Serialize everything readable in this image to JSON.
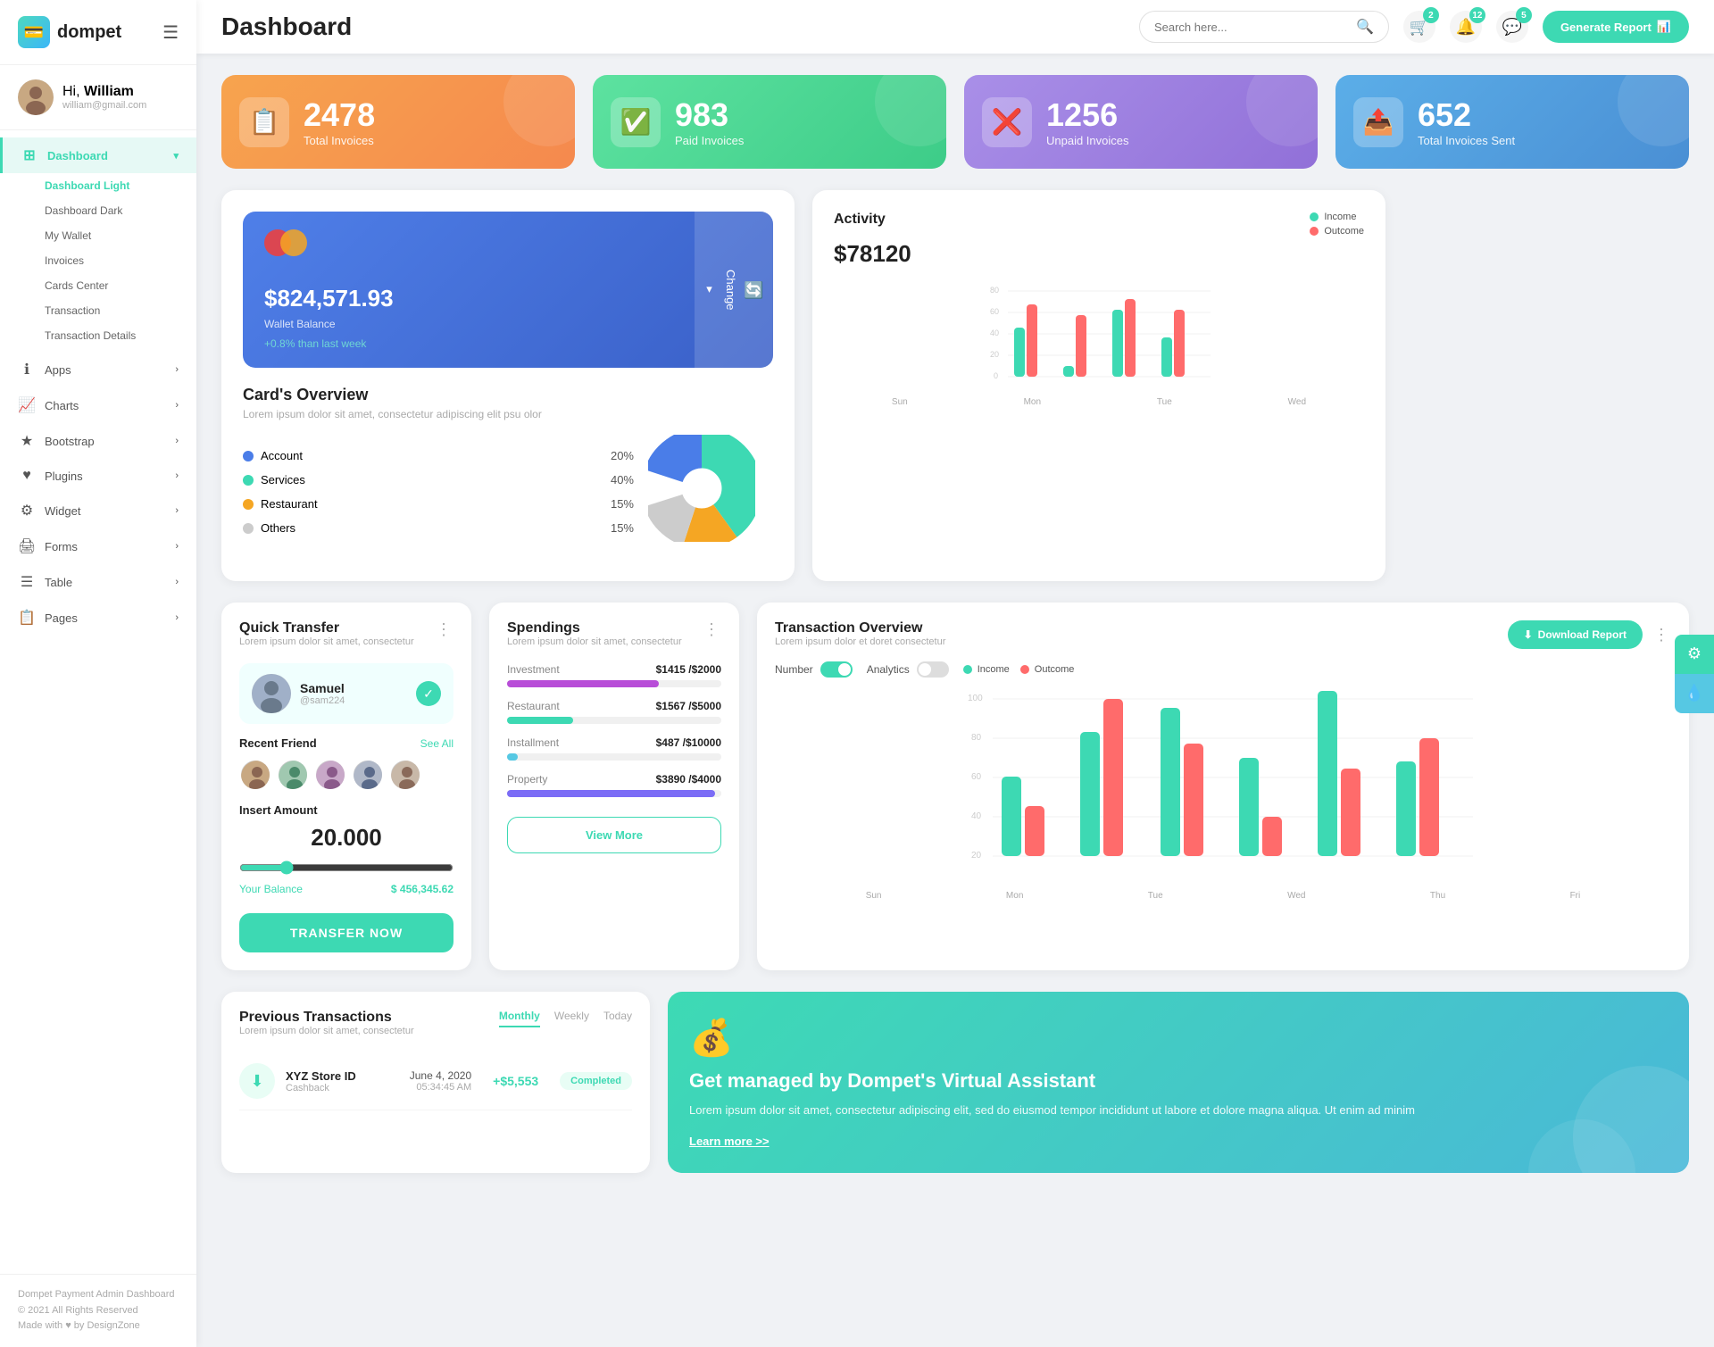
{
  "sidebar": {
    "logo_text": "dompet",
    "user": {
      "greeting": "Hi,",
      "name": "William",
      "email": "william@gmail.com"
    },
    "nav": [
      {
        "id": "dashboard",
        "label": "Dashboard",
        "icon": "⊞",
        "active": true,
        "badge": null,
        "arrow": "▾",
        "sub_items": [
          {
            "label": "Dashboard Light",
            "active": true
          },
          {
            "label": "Dashboard Dark",
            "active": false
          },
          {
            "label": "My Wallet",
            "active": false
          },
          {
            "label": "Invoices",
            "active": false
          },
          {
            "label": "Cards Center",
            "active": false
          },
          {
            "label": "Transaction",
            "active": false
          },
          {
            "label": "Transaction Details",
            "active": false
          }
        ]
      },
      {
        "id": "apps",
        "label": "Apps",
        "icon": "ℹ",
        "arrow": "›"
      },
      {
        "id": "charts",
        "label": "Charts",
        "icon": "📈",
        "arrow": "›"
      },
      {
        "id": "bootstrap",
        "label": "Bootstrap",
        "icon": "★",
        "arrow": "›"
      },
      {
        "id": "plugins",
        "label": "Plugins",
        "icon": "♥",
        "arrow": "›"
      },
      {
        "id": "widget",
        "label": "Widget",
        "icon": "⚙",
        "arrow": "›"
      },
      {
        "id": "forms",
        "label": "Forms",
        "icon": "🖨",
        "arrow": "›"
      },
      {
        "id": "table",
        "label": "Table",
        "icon": "☰",
        "arrow": "›"
      },
      {
        "id": "pages",
        "label": "Pages",
        "icon": "📋",
        "arrow": "›"
      }
    ],
    "footer": {
      "brand": "Dompet Payment Admin Dashboard",
      "copyright": "© 2021 All Rights Reserved",
      "made_with": "Made with ♥ by DesignZone"
    }
  },
  "header": {
    "title": "Dashboard",
    "search_placeholder": "Search here...",
    "icons": {
      "cart_badge": "2",
      "bell_badge": "12",
      "chat_badge": "5"
    },
    "generate_btn": "Generate Report"
  },
  "stat_cards": [
    {
      "number": "2478",
      "label": "Total Invoices",
      "color": "orange",
      "icon": "📋"
    },
    {
      "number": "983",
      "label": "Paid Invoices",
      "color": "green",
      "icon": "✓"
    },
    {
      "number": "1256",
      "label": "Unpaid Invoices",
      "color": "purple",
      "icon": "✗"
    },
    {
      "number": "652",
      "label": "Total Invoices Sent",
      "color": "teal",
      "icon": "📋"
    }
  ],
  "wallet_card": {
    "balance": "$824,571.93",
    "label": "Wallet Balance",
    "growth": "+0.8% than last week",
    "change_btn": "Change"
  },
  "cards_overview": {
    "title": "Card's Overview",
    "sub": "Lorem ipsum dolor sit amet, consectetur adipiscing elit psu olor",
    "items": [
      {
        "label": "Account",
        "pct": "20%",
        "color": "#4a7de8"
      },
      {
        "label": "Services",
        "pct": "40%",
        "color": "#3dd9b3"
      },
      {
        "label": "Restaurant",
        "pct": "15%",
        "color": "#f5a623"
      },
      {
        "label": "Others",
        "pct": "15%",
        "color": "#ccc"
      }
    ]
  },
  "activity": {
    "title": "Activity",
    "amount": "$78120",
    "income_label": "Income",
    "outcome_label": "Outcome",
    "income_color": "#3dd9b3",
    "outcome_color": "#ff6b6b",
    "bars": {
      "labels": [
        "Sun",
        "Mon",
        "Tue",
        "Wed"
      ],
      "income": [
        45,
        10,
        60,
        35
      ],
      "outcome": [
        65,
        55,
        70,
        60
      ]
    }
  },
  "quick_transfer": {
    "title": "Quick Transfer",
    "sub": "Lorem ipsum dolor sit amet, consectetur",
    "selected_friend": {
      "name": "Samuel",
      "handle": "@sam224"
    },
    "recent_label": "Recent Friend",
    "see_all": "See All",
    "insert_amount_label": "Insert Amount",
    "amount": "20.000",
    "balance_label": "Your Balance",
    "balance_value": "$ 456,345.62",
    "transfer_btn": "TRANSFER NOW"
  },
  "spendings": {
    "title": "Spendings",
    "sub": "Lorem ipsum dolor sit amet, consectetur",
    "items": [
      {
        "label": "Investment",
        "current": 1415,
        "max": 2000,
        "display": "$1415 /$2000",
        "color": "#b84dd8",
        "pct": 71
      },
      {
        "label": "Restaurant",
        "current": 1567,
        "max": 5000,
        "display": "$1567 /$5000",
        "color": "#3dd9b3",
        "pct": 31
      },
      {
        "label": "Installment",
        "current": 487,
        "max": 10000,
        "display": "$487 /$10000",
        "color": "#56c8e3",
        "pct": 5
      },
      {
        "label": "Property",
        "current": 3890,
        "max": 4000,
        "display": "$3890 /$4000",
        "color": "#7b6cf6",
        "pct": 97
      }
    ],
    "view_more_btn": "View More"
  },
  "transaction_overview": {
    "title": "Transaction Overview",
    "sub": "Lorem ipsum dolor et doret consectetur",
    "number_label": "Number",
    "analytics_label": "Analytics",
    "income_label": "Income",
    "outcome_label": "Outcome",
    "download_btn": "Download Report",
    "bars": {
      "labels": [
        "Sun",
        "Mon",
        "Tue",
        "Wed",
        "Thu",
        "Fri"
      ],
      "income": [
        45,
        68,
        78,
        55,
        90,
        52
      ],
      "outcome": [
        30,
        80,
        58,
        20,
        45,
        65
      ]
    }
  },
  "previous_transactions": {
    "title": "Previous Transactions",
    "sub": "Lorem ipsum dolor sit amet, consectetur",
    "tabs": [
      "Monthly",
      "Weekly",
      "Today"
    ],
    "active_tab": "Monthly",
    "items": [
      {
        "name": "XYZ Store ID",
        "type": "Cashback",
        "date": "June 4, 2020",
        "time": "05:34:45 AM",
        "amount": "+$5,553",
        "status": "Completed",
        "icon_color": "#e8fdf5",
        "icon_text_color": "#3dd9b3"
      }
    ]
  },
  "virtual_assistant": {
    "title": "Get managed by Dompet's Virtual Assistant",
    "desc": "Lorem ipsum dolor sit amet, consectetur adipiscing elit, sed do eiusmod tempor incididunt ut labore et dolore magna aliqua. Ut enim ad minim",
    "link": "Learn more >>"
  }
}
